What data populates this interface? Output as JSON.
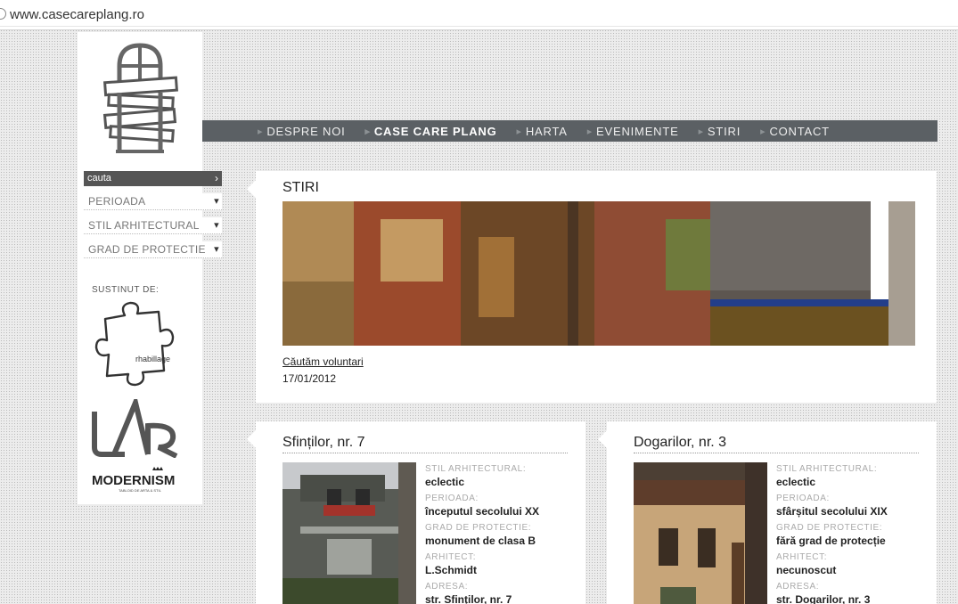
{
  "browser": {
    "url": "www.casecareplang.ro"
  },
  "nav": {
    "items": [
      {
        "label": "DESPRE NOI",
        "active": false
      },
      {
        "label": "CASE CARE PLANG",
        "active": true
      },
      {
        "label": "HARTA",
        "active": false
      },
      {
        "label": "EVENIMENTE",
        "active": false
      },
      {
        "label": "STIRI",
        "active": false
      },
      {
        "label": "CONTACT",
        "active": false
      }
    ]
  },
  "sidebar": {
    "search_label": "cauta",
    "filters": [
      "PERIOADA",
      "STIL ARHITECTURAL",
      "GRAD DE PROTECTIE"
    ],
    "supported_by": "SUSTINUT DE:",
    "sponsors": {
      "puzzle_text": "rhabillage",
      "modernism_text": "MODERNISM",
      "modernism_tagline": "TABLOID DE ARTA & STIL"
    }
  },
  "news": {
    "heading": "STIRI",
    "link": "Căutăm voluntari",
    "date": "17/01/2012"
  },
  "cards": [
    {
      "title": "Sfinților, nr. 7",
      "specs": [
        {
          "label": "STIL ARHITECTURAL:",
          "value": "eclectic"
        },
        {
          "label": "PERIOADA:",
          "value": "începutul secolului XX"
        },
        {
          "label": "GRAD DE PROTECTIE:",
          "value": "monument de clasa B"
        },
        {
          "label": "ARHITECT:",
          "value": "L.Schmidt"
        },
        {
          "label": "ADRESA:",
          "value": "str. Sfinților, nr. 7"
        }
      ]
    },
    {
      "title": "Dogarilor, nr. 3",
      "specs": [
        {
          "label": "STIL ARHITECTURAL:",
          "value": "eclectic"
        },
        {
          "label": "PERIOADA:",
          "value": "sfârșitul secolului XIX"
        },
        {
          "label": "GRAD DE PROTECTIE:",
          "value": "fără grad de protecție"
        },
        {
          "label": "ARHITECT:",
          "value": "necunoscut"
        },
        {
          "label": "ADRESA:",
          "value": "str. Dogarilor, nr. 3"
        }
      ]
    }
  ],
  "colors": {
    "nav_bg": "#5b6064",
    "search_bg": "#555555",
    "page_bg": "#ececec"
  }
}
